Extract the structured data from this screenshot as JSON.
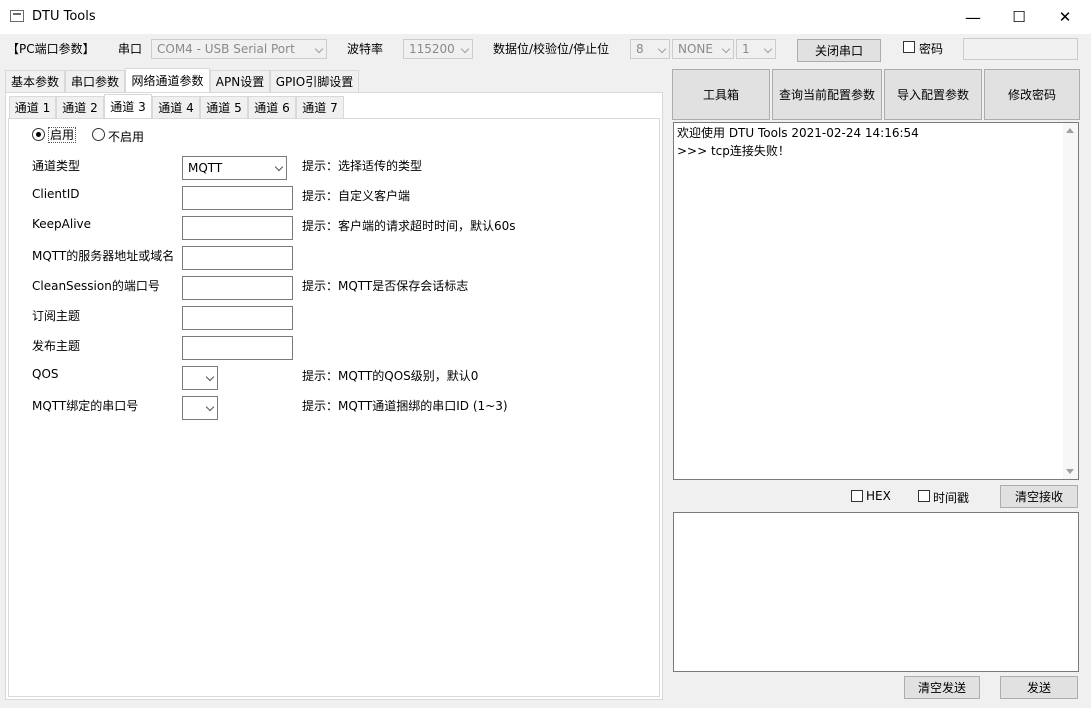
{
  "window": {
    "title": "DTU Tools",
    "minimize": "—",
    "maximize": "☐",
    "close": "✕"
  },
  "serial_bar": {
    "section_label": "【PC端口参数】",
    "port_label": "串口",
    "port_value": "COM4 - USB Serial Port",
    "baud_label": "波特率",
    "baud_value": "115200",
    "frame_label": "数据位/校验位/停止位",
    "databits_value": "8",
    "parity_value": "NONE",
    "stopbits_value": "1",
    "close_port_button": "关闭串口",
    "password_label": "密码",
    "password_checked": false
  },
  "main_tabs": [
    {
      "label": "基本参数",
      "active": false
    },
    {
      "label": "串口参数",
      "active": false
    },
    {
      "label": "网络通道参数",
      "active": true
    },
    {
      "label": "APN设置",
      "active": false
    },
    {
      "label": "GPIO引脚设置",
      "active": false
    }
  ],
  "channel_tabs": [
    {
      "label": "通道 1",
      "active": false
    },
    {
      "label": "通道 2",
      "active": false
    },
    {
      "label": "通道 3",
      "active": true
    },
    {
      "label": "通道 4",
      "active": false
    },
    {
      "label": "通道 5",
      "active": false
    },
    {
      "label": "通道 6",
      "active": false
    },
    {
      "label": "通道 7",
      "active": false
    }
  ],
  "channel": {
    "enable_label": "启用",
    "disable_label": "不启用",
    "enabled": true,
    "rows": [
      {
        "label": "通道类型",
        "control": "combo",
        "value": "MQTT",
        "hint": "提示：选择适传的类型"
      },
      {
        "label": "ClientID",
        "control": "input",
        "value": "",
        "hint": "提示：自定义客户端"
      },
      {
        "label": "KeepAlive",
        "control": "input",
        "value": "",
        "hint": "提示：客户端的请求超时时间，默认60s"
      },
      {
        "label": "MQTT的服务器地址或域名",
        "control": "input",
        "value": "",
        "hint": ""
      },
      {
        "label": "CleanSession的端口号",
        "control": "input",
        "value": "",
        "hint": "提示：MQTT是否保存会话标志"
      },
      {
        "label": "订阅主题",
        "control": "input",
        "value": "",
        "hint": ""
      },
      {
        "label": "发布主题",
        "control": "input",
        "value": "",
        "hint": ""
      },
      {
        "label": "QOS",
        "control": "small-combo",
        "value": "",
        "hint": "提示：MQTT的QOS级别，默认0"
      },
      {
        "label": "MQTT绑定的串口号",
        "control": "small-combo",
        "value": "",
        "hint": "提示：MQTT通道捆绑的串口ID (1~3)"
      }
    ]
  },
  "toolbar": {
    "toolbox": "工具箱",
    "query_config": "查询当前配置参数",
    "import_config": "导入配置参数",
    "change_password": "修改密码"
  },
  "receive": {
    "lines": [
      "欢迎使用 DTU Tools 2021-02-24 14:16:54",
      ">>> tcp连接失败！"
    ],
    "hex_label": "HEX",
    "hex_checked": false,
    "timestamp_label": "时间戳",
    "timestamp_checked": false,
    "clear_button": "清空接收"
  },
  "send": {
    "value": "",
    "clear_button": "清空发送",
    "send_button": "发送"
  }
}
